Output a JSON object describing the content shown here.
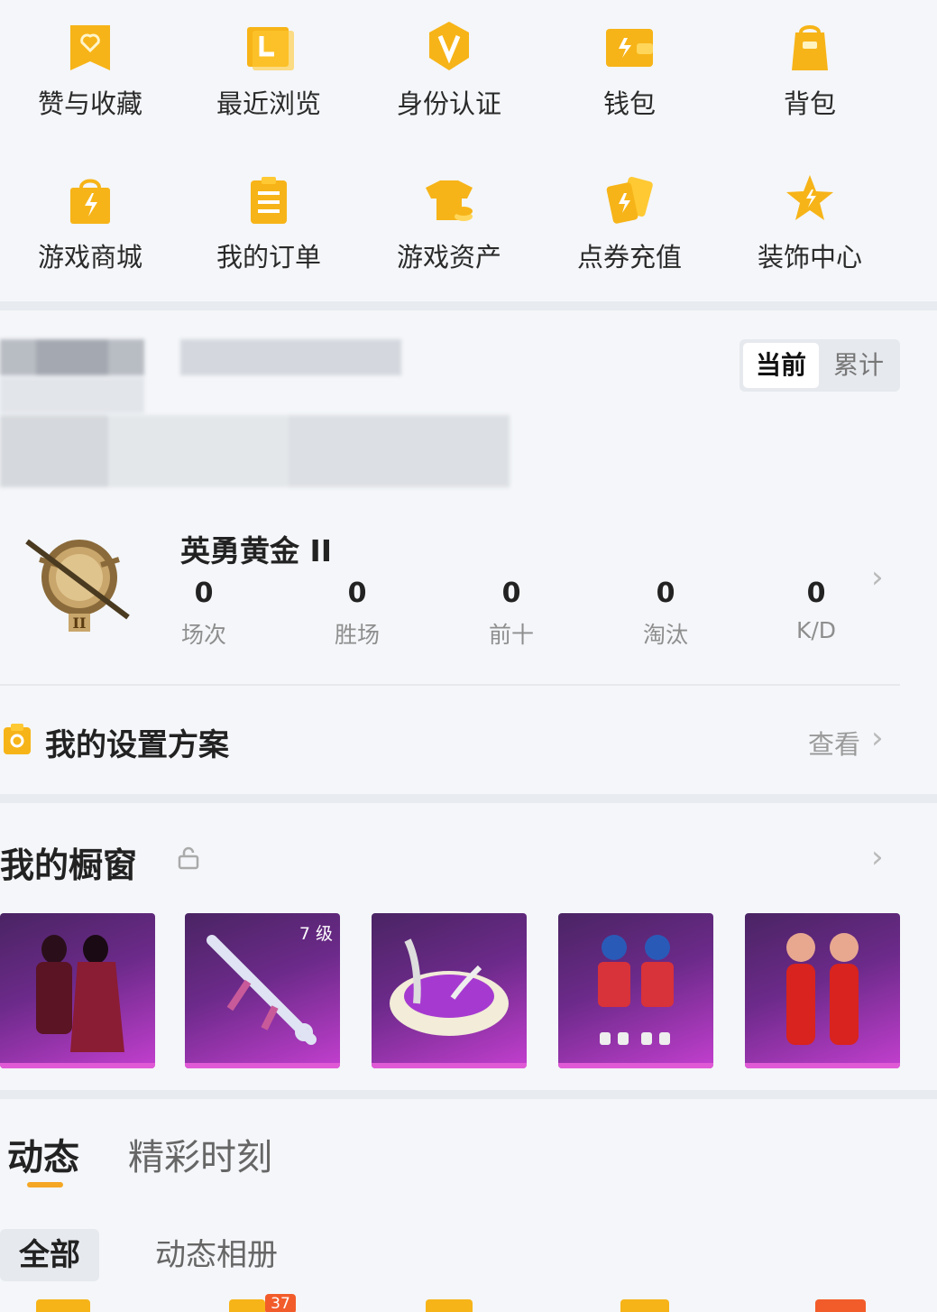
{
  "shortcuts": [
    {
      "label": "赞与收藏",
      "icon": "bookmark-heart-icon"
    },
    {
      "label": "最近浏览",
      "icon": "history-folder-icon"
    },
    {
      "label": "身份认证",
      "icon": "verified-v-icon"
    },
    {
      "label": "钱包",
      "icon": "wallet-icon"
    },
    {
      "label": "背包",
      "icon": "backpack-icon"
    },
    {
      "label": "游戏商城",
      "icon": "shopping-bag-icon"
    },
    {
      "label": "我的订单",
      "icon": "order-list-icon"
    },
    {
      "label": "游戏资产",
      "icon": "shirt-coin-icon"
    },
    {
      "label": "点券充值",
      "icon": "coupon-cards-icon"
    },
    {
      "label": "装饰中心",
      "icon": "star-decoration-icon"
    }
  ],
  "toggle": {
    "current": "当前",
    "total": "累计"
  },
  "rank": {
    "title": "英勇黄金 II",
    "stats": [
      {
        "value": "0",
        "label": "场次"
      },
      {
        "value": "0",
        "label": "胜场"
      },
      {
        "value": "0",
        "label": "前十"
      },
      {
        "value": "0",
        "label": "淘汰"
      },
      {
        "value": "0",
        "label": "K/D"
      }
    ]
  },
  "settings": {
    "title": "我的设置方案",
    "view": "查看"
  },
  "showcase": {
    "title": "我的橱窗",
    "items": [
      {
        "name": "dark-outfit-pair"
      },
      {
        "name": "rifle-skin",
        "level": "7 级"
      },
      {
        "name": "parachute-pod"
      },
      {
        "name": "mascot-outfits"
      },
      {
        "name": "red-suit-pair"
      }
    ]
  },
  "feed_tabs": {
    "active": "动态",
    "inactive": "精彩时刻"
  },
  "filters": {
    "active": "全部",
    "inactive": "动态相册"
  },
  "badge_count": "37",
  "colors": {
    "accent": "#f5a623",
    "card": "#6c2a8a"
  }
}
